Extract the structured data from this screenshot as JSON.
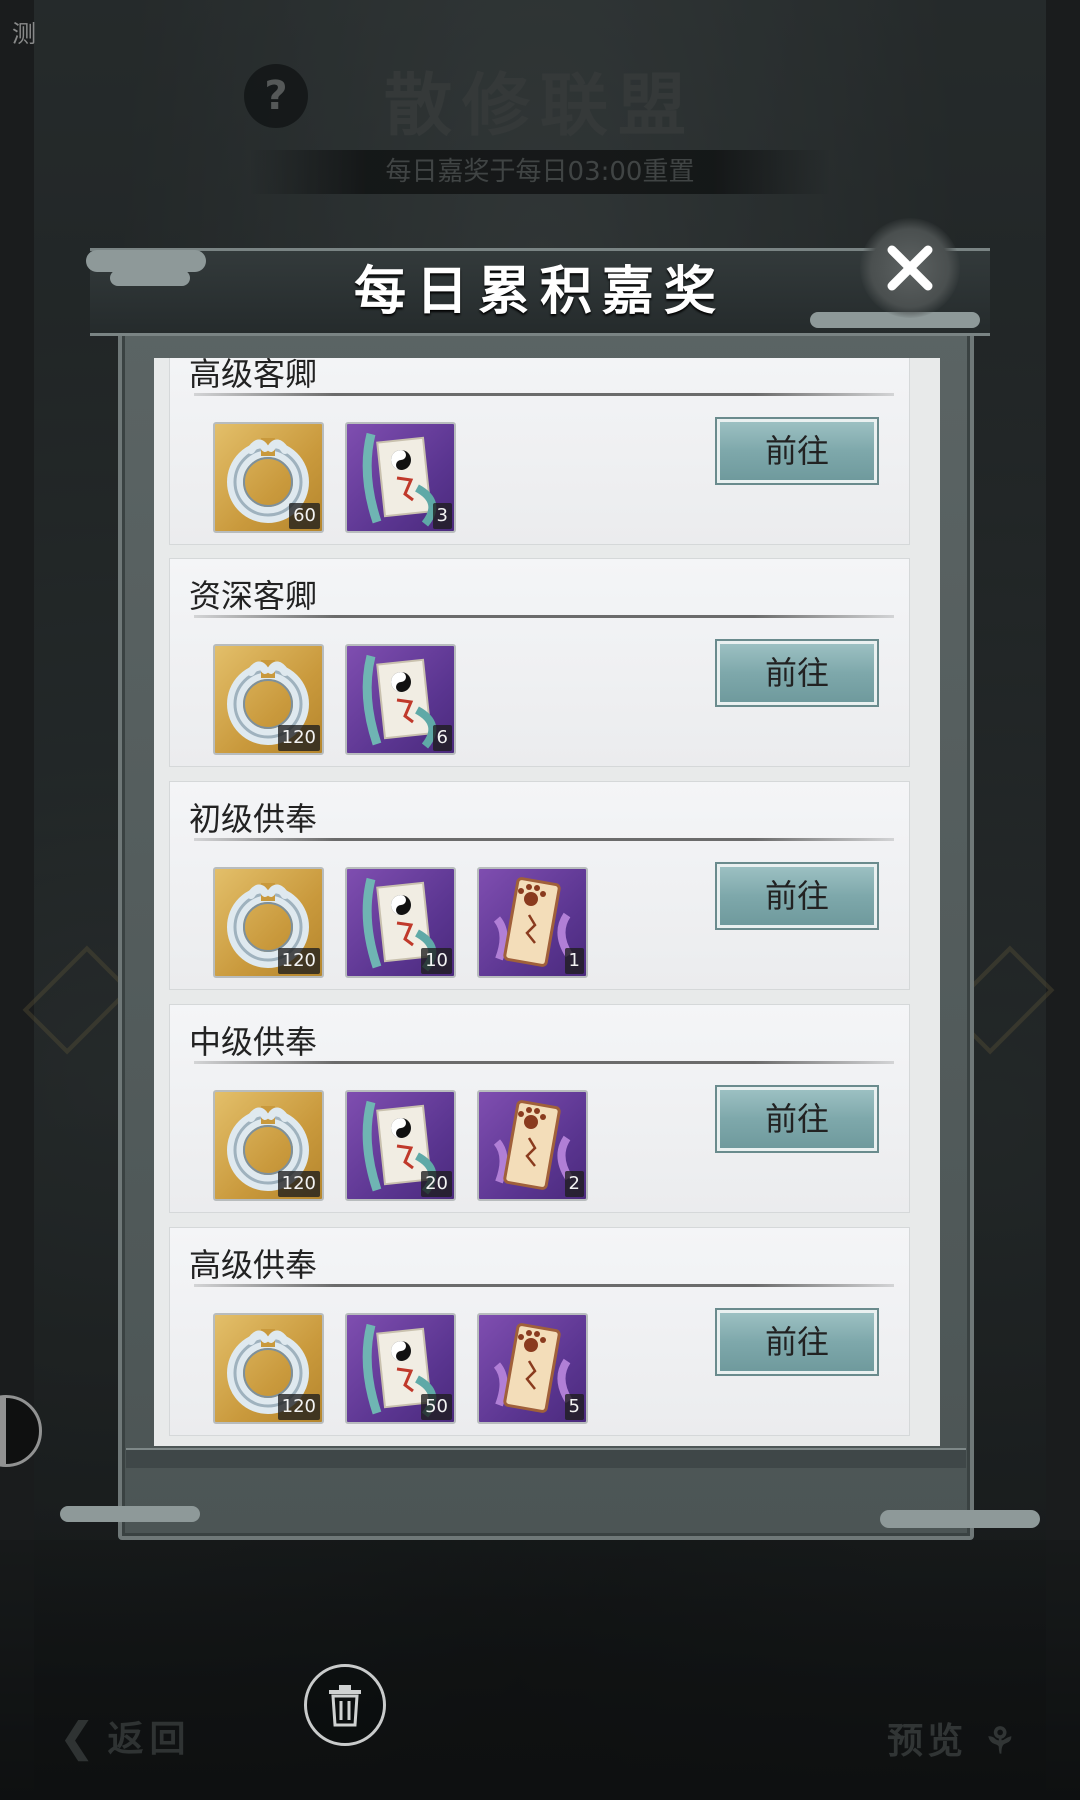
{
  "background": {
    "edge_text": "测",
    "help_icon": "?",
    "title": "散修联盟",
    "subtitle": "每日嘉奖于每日03:00重置",
    "back_label": "返回",
    "preview_label": "预览"
  },
  "dialog": {
    "title": "每日累积嘉奖",
    "close_icon": "close-icon",
    "rows": [
      {
        "tier": "高级客卿",
        "button": "前往",
        "items": [
          {
            "type": "jade-ring",
            "count": "60"
          },
          {
            "type": "taiji-talisman",
            "count": "3"
          }
        ]
      },
      {
        "tier": "资深客卿",
        "button": "前往",
        "items": [
          {
            "type": "jade-ring",
            "count": "120"
          },
          {
            "type": "taiji-talisman",
            "count": "6"
          }
        ]
      },
      {
        "tier": "初级供奉",
        "button": "前往",
        "items": [
          {
            "type": "jade-ring",
            "count": "120"
          },
          {
            "type": "taiji-talisman",
            "count": "10"
          },
          {
            "type": "paw-scroll",
            "count": "1"
          }
        ]
      },
      {
        "tier": "中级供奉",
        "button": "前往",
        "items": [
          {
            "type": "jade-ring",
            "count": "120"
          },
          {
            "type": "taiji-talisman",
            "count": "20"
          },
          {
            "type": "paw-scroll",
            "count": "2"
          }
        ]
      },
      {
        "tier": "高级供奉",
        "button": "前往",
        "items": [
          {
            "type": "jade-ring",
            "count": "120"
          },
          {
            "type": "taiji-talisman",
            "count": "50"
          },
          {
            "type": "paw-scroll",
            "count": "5"
          }
        ]
      }
    ]
  },
  "colors": {
    "button_teal": "#7ea8ab",
    "slot_gold": "#c9993c",
    "slot_purple": "#5a3590"
  }
}
